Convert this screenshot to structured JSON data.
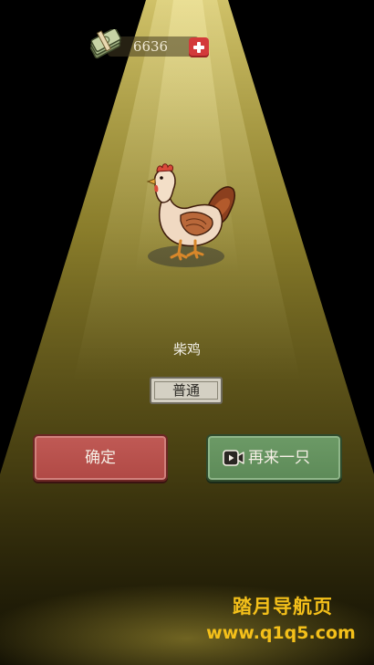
{
  "currency": {
    "amount": "6636",
    "money_icon": "cash-stack-icon",
    "plus_icon": "plus-icon"
  },
  "pet": {
    "name": "柴鸡",
    "rarity": "普通"
  },
  "buttons": {
    "confirm_label": "确定",
    "again_label": "再来一只",
    "again_icon": "video-icon"
  },
  "watermark": {
    "line1": "踏月导航页",
    "line2": "www.q1q5.com"
  },
  "colors": {
    "confirm": "#b8504b",
    "again": "#64935f",
    "spotlight": "#e6d35a",
    "watermark": "#f4c01a"
  }
}
